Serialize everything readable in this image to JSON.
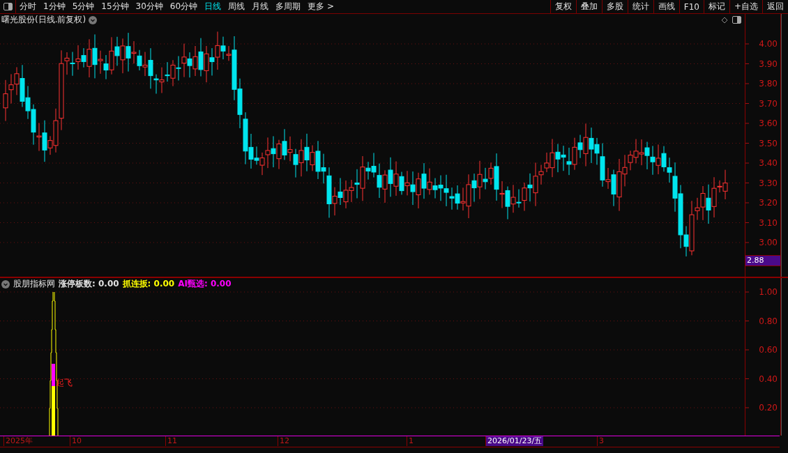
{
  "toolbar": {
    "periods": [
      {
        "label": "分时",
        "selected": false
      },
      {
        "label": "1分钟",
        "selected": false
      },
      {
        "label": "5分钟",
        "selected": false
      },
      {
        "label": "15分钟",
        "selected": false
      },
      {
        "label": "30分钟",
        "selected": false
      },
      {
        "label": "60分钟",
        "selected": false
      },
      {
        "label": "日线",
        "selected": true
      },
      {
        "label": "周线",
        "selected": false
      },
      {
        "label": "月线",
        "selected": false
      },
      {
        "label": "多周期",
        "selected": false
      },
      {
        "label": "更多 >",
        "selected": false
      }
    ],
    "actions": [
      "复权",
      "叠加",
      "多股",
      "统计",
      "画线",
      "F10",
      "标记",
      "+自选",
      "返回"
    ]
  },
  "main_chart": {
    "title": "曙光股份(日线.前复权)",
    "price_ticks": [
      "4.00",
      "3.90",
      "3.80",
      "3.70",
      "3.60",
      "3.50",
      "3.40",
      "3.30",
      "3.20",
      "3.10",
      "3.00"
    ],
    "last_price": "2.88"
  },
  "indicator": {
    "name": "股朋指标网",
    "values": [
      {
        "label": "涨停板数:",
        "value": "0.00",
        "color": "#e0e0e0"
      },
      {
        "label": "抓连扳:",
        "value": "0.00",
        "color": "#ffff00"
      },
      {
        "label": "AI甄选:",
        "value": "0.00",
        "color": "#ff00ff"
      }
    ],
    "signal_label": "起飞",
    "ticks": [
      "1.00",
      "0.80",
      "0.60",
      "0.40",
      "0.20"
    ]
  },
  "date_axis": {
    "labels": [
      {
        "label": "2025年",
        "selected": false
      },
      {
        "label": "10",
        "selected": false
      },
      {
        "label": "11",
        "selected": false
      },
      {
        "label": "12",
        "selected": false
      },
      {
        "label": "1",
        "selected": false
      },
      {
        "label": "2026/01/23/五",
        "selected": true
      },
      {
        "label": "3",
        "selected": false
      }
    ]
  }
}
